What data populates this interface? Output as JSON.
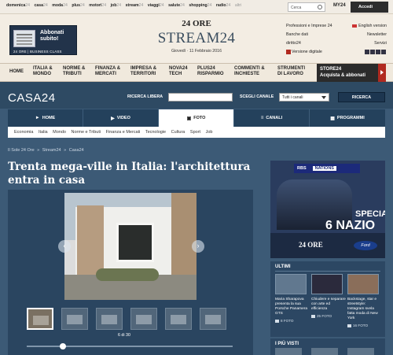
{
  "topbar": {
    "links": [
      {
        "main": "domenica",
        "sub": "24"
      },
      {
        "main": "casa",
        "sub": "24"
      },
      {
        "main": "moda",
        "sub": "24"
      },
      {
        "main": "plus",
        "sub": "24"
      },
      {
        "main": "motori",
        "sub": "24"
      },
      {
        "main": "job",
        "sub": "24"
      },
      {
        "main": "stream",
        "sub": "24"
      },
      {
        "main": "viaggi",
        "sub": "24"
      },
      {
        "main": "salute",
        "sub": "24"
      },
      {
        "main": "shopping",
        "sub": "24"
      },
      {
        "main": "radio",
        "sub": "24"
      },
      {
        "main": "",
        "sub": "altri"
      }
    ],
    "search_placeholder": "Cerca",
    "my24": "MY24",
    "login": "Accedi"
  },
  "masthead": {
    "promo_line1": "Abbonati",
    "promo_line2": "subito!",
    "promo_footer": "24 ORE | BUSINESS CLASS",
    "brand_small": "24 ORE",
    "brand_big": "STREAM24",
    "date": "Giovedì · 11 Febbraio 2016",
    "right_links": [
      [
        "Professioni e Imprese 24",
        "English version"
      ],
      [
        "Banche dati",
        "Newsletter"
      ],
      [
        "diritto24",
        "Servizi"
      ],
      [
        "Versione digitale",
        ""
      ]
    ]
  },
  "mainnav": {
    "items": [
      [
        "HOME",
        ""
      ],
      [
        "ITALIA &",
        "MONDO"
      ],
      [
        "NORME &",
        "TRIBUTI"
      ],
      [
        "FINANZA &",
        "MERCATI"
      ],
      [
        "IMPRESA &",
        "TERRITORI"
      ],
      [
        "NOVA24",
        "TECH"
      ],
      [
        "PLUS24",
        "RISPARMIO"
      ],
      [
        "COMMENTI &",
        "INCHIESTE"
      ],
      [
        "STRUMENTI",
        "DI LAVORO"
      ]
    ],
    "store_line1": "STORE24",
    "store_line2": "Acquista & abbonati"
  },
  "section": {
    "title": "CASA24",
    "free_search_label": "RICERCA LIBERA",
    "channel_label": "SCEGLI CANALE",
    "channel_value": "Tutti i canali",
    "search_button": "RICERCA"
  },
  "tabs": [
    {
      "label": "HOME",
      "icon": "►"
    },
    {
      "label": "VIDEO",
      "icon": "▶"
    },
    {
      "label": "FOTO",
      "icon": "▣"
    },
    {
      "label": "CANALI",
      "icon": "≡"
    },
    {
      "label": "PROGRAMMI",
      "icon": "▦"
    }
  ],
  "subnav": [
    "Economia",
    "Italia",
    "Mondo",
    "Norme e Tributi",
    "Finanza e Mercati",
    "Tecnologie",
    "Cultura",
    "Sport",
    "Job"
  ],
  "breadcrumb": [
    "Il Sole 24 Ore",
    "»",
    "Stream24",
    "»",
    "Casa24"
  ],
  "headline": "Trenta mega-ville in Italia: l'architettura entra in casa",
  "gallery": {
    "counter": "6 di 30",
    "prev_icon": "chevron-left-icon",
    "next_icon": "chevron-right-icon"
  },
  "ad": {
    "sponsor": "RBS",
    "sponsor_tag": "NATIONS",
    "special": "SPECIAL",
    "nazioni": "6 NAZIO",
    "logo": "24 ORE",
    "brand": "Ford"
  },
  "ultimi": {
    "heading": "ULTIMI",
    "items": [
      {
        "text": "Maria Sharapova presenta la sua Porsche Panamera GTS",
        "count": "8 FOTO"
      },
      {
        "text": "Chiudere e separare con arte ed efficienza",
        "count": "25 FOTO"
      },
      {
        "text": "Backstage, star e streetstyle: Instagram svela fatta moda di New York",
        "count": "16 FOTO"
      }
    ]
  },
  "piuvisti": {
    "heading": "I PIÙ VISTI"
  }
}
